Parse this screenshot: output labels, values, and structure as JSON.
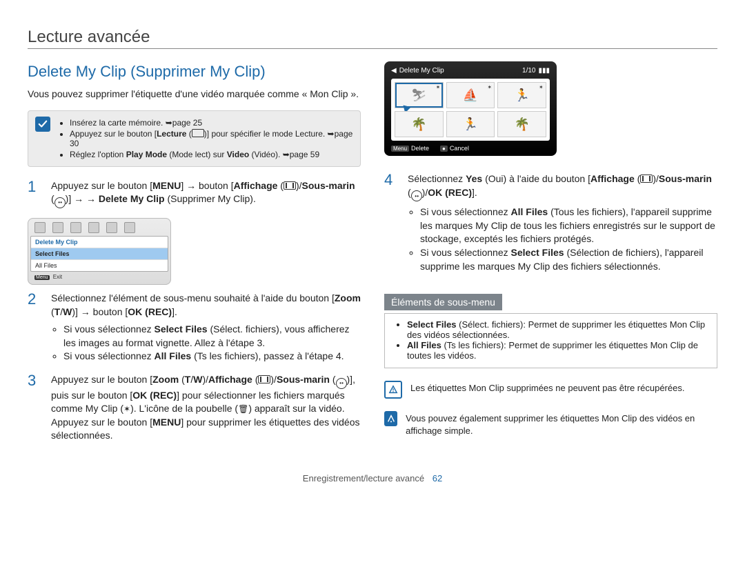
{
  "chapter": "Lecture avancée",
  "section_title": "Delete My Clip (Supprimer My Clip)",
  "intro": "Vous pouvez supprimer l'étiquette d'une vidéo marquée comme « Mon Clip ».",
  "prep": {
    "items": [
      "Insérez la carte mémoire. ➥page 25",
      "Appuyez sur le bouton [Lecture (▶)] pour spécifier le mode Lecture. ➥page 30",
      "Réglez l'option Play Mode (Mode lect) sur Video (Vidéo). ➥page 59"
    ]
  },
  "steps_left": [
    {
      "n": 1,
      "html": "Appuyez sur le bouton [<b>MENU</b>] → bouton [<b>Affichage</b> (<span class='rect-icon bars'></span>)/<b>Sous-marin</b> (<span class='face-icon'></span>)] → → <b>Delete My Clip</b> (Supprimer My Clip)."
    },
    {
      "n": 2,
      "html": "Sélectionnez l'élément de sous-menu souhaité à l'aide du bouton [<b>Zoom</b> (<b>T</b>/<b>W</b>)] → bouton [<b>OK (REC)</b>].",
      "bullets": [
        "Si vous sélectionnez <b>Select Files</b> (Sélect. fichiers), vous afficherez les images au format vignette. Allez à l'étape 3.",
        "Si vous sélectionnez <b>All Files</b> (Ts les fichiers), passez à l'étape 4."
      ]
    },
    {
      "n": 3,
      "html": "Appuyez sur le bouton [<b>Zoom</b> (<b>T</b>/<b>W</b>)/<b>Affichage</b> (<span class='rect-icon bars'></span>)/<b>Sous-marin</b> (<span class='face-icon'></span>)], puis sur le bouton [<b>OK (REC)</b>] pour sélectionner les fichiers marqués comme My Clip (<span class='star-icon'>✶</span>). L'icône de la poubelle (<span class='star-icon'>🗑</span>) apparaît sur la vidéo. Appuyez sur le bouton [<b>MENU</b>] pour supprimer les étiquettes des vidéos sélectionnées."
    }
  ],
  "ui_menu": {
    "title": "Delete My Clip",
    "items": [
      "Delete My Clip",
      "Select Files",
      "All Files"
    ],
    "footer_btn": "Menu",
    "footer_label": "Exit"
  },
  "ui_grid": {
    "title": "Delete My Clip",
    "counter": "1/10",
    "footer": [
      {
        "btn": "Menu",
        "label": "Delete"
      },
      {
        "btn": "●",
        "label": "Cancel"
      }
    ]
  },
  "steps_right": [
    {
      "n": 4,
      "html": "Sélectionnez <b>Yes</b> (Oui) à l'aide du bouton [<b>Affichage</b> (<span class='rect-icon bars'></span>)/<b>Sous-marin</b> (<span class='face-icon'></span>)/<b>OK (REC)</b>].",
      "bullets": [
        "Si vous sélectionnez <b>All Files</b> (Tous les fichiers), l'appareil supprime les marques My Clip de tous les fichiers enregistrés sur le support de stockage, exceptés les fichiers protégés.",
        "Si vous sélectionnez <b>Select Files</b> (Sélection de fichiers), l'appareil supprime les marques My Clip des fichiers sélectionnés."
      ]
    }
  ],
  "submenu": {
    "header": "Éléments de sous-menu",
    "items": [
      "<b>Select Files</b> (Sélect. fichiers): Permet de supprimer les étiquettes Mon Clip des vidéos sélectionnées.",
      "<b>All Files</b> (Ts les fichiers): Permet de supprimer les étiquettes Mon Clip de toutes les vidéos."
    ]
  },
  "warning": "Les étiquettes Mon Clip supprimées ne peuvent pas être récupérées.",
  "tip": "Vous pouvez également supprimer les étiquettes Mon Clip des vidéos en affichage simple.",
  "footer": {
    "label": "Enregistrement/lecture avancé",
    "page": "62"
  }
}
